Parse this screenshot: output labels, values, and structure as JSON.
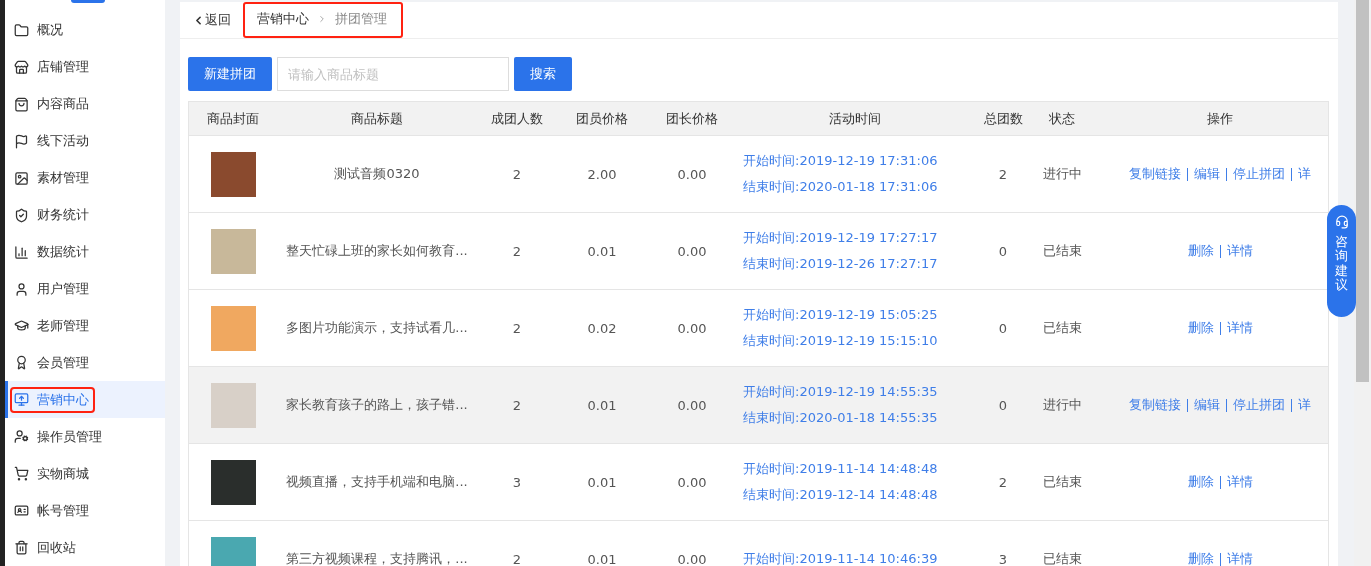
{
  "sidebar": {
    "items": [
      {
        "label": "概况",
        "selected": false
      },
      {
        "label": "店铺管理",
        "selected": false
      },
      {
        "label": "内容商品",
        "selected": false
      },
      {
        "label": "线下活动",
        "selected": false
      },
      {
        "label": "素材管理",
        "selected": false
      },
      {
        "label": "财务统计",
        "selected": false
      },
      {
        "label": "数据统计",
        "selected": false
      },
      {
        "label": "用户管理",
        "selected": false
      },
      {
        "label": "老师管理",
        "selected": false
      },
      {
        "label": "会员管理",
        "selected": false
      },
      {
        "label": "营销中心",
        "selected": true
      },
      {
        "label": "操作员管理",
        "selected": false
      },
      {
        "label": "实物商城",
        "selected": false
      },
      {
        "label": "帐号管理",
        "selected": false
      },
      {
        "label": "回收站",
        "selected": false
      }
    ]
  },
  "header": {
    "back": "返回",
    "breadcrumb": [
      "营销中心",
      "拼团管理"
    ]
  },
  "toolbar": {
    "new_button": "新建拼团",
    "search": {
      "placeholder": "请输入商品标题"
    },
    "search_button": "搜索"
  },
  "table": {
    "columns": [
      "商品封面",
      "商品标题",
      "成团人数",
      "团员价格",
      "团长价格",
      "活动时间",
      "总团数",
      "状态",
      "操作"
    ],
    "rows": [
      {
        "title": "测试音频0320",
        "size": "2",
        "member_price": "2.00",
        "leader_price": "0.00",
        "start": "开始时间:2019-12-19 17:31:06",
        "end": "结束时间:2020-01-18 17:31:06",
        "groups": "2",
        "status": "进行中",
        "actions": [
          "复制链接",
          "编辑",
          "停止拼团",
          "详"
        ],
        "highlighted": false
      },
      {
        "title": "整天忙碌上班的家长如何教育...",
        "size": "2",
        "member_price": "0.01",
        "leader_price": "0.00",
        "start": "开始时间:2019-12-19 17:27:17",
        "end": "结束时间:2019-12-26 17:27:17",
        "groups": "0",
        "status": "已结束",
        "actions": [
          "删除",
          "详情"
        ],
        "highlighted": false
      },
      {
        "title": "多图片功能演示，支持试看几...",
        "size": "2",
        "member_price": "0.02",
        "leader_price": "0.00",
        "start": "开始时间:2019-12-19 15:05:25",
        "end": "结束时间:2019-12-19 15:15:10",
        "groups": "0",
        "status": "已结束",
        "actions": [
          "删除",
          "详情"
        ],
        "highlighted": false
      },
      {
        "title": "家长教育孩子的路上，孩子错...",
        "size": "2",
        "member_price": "0.01",
        "leader_price": "0.00",
        "start": "开始时间:2019-12-19 14:55:35",
        "end": "结束时间:2020-01-18 14:55:35",
        "groups": "0",
        "status": "进行中",
        "actions": [
          "复制链接",
          "编辑",
          "停止拼团",
          "详"
        ],
        "highlighted": true
      },
      {
        "title": "视频直播，支持手机端和电脑...",
        "size": "3",
        "member_price": "0.01",
        "leader_price": "0.00",
        "start": "开始时间:2019-11-14 14:48:48",
        "end": "结束时间:2019-12-14 14:48:48",
        "groups": "2",
        "status": "已结束",
        "actions": [
          "删除",
          "详情"
        ],
        "highlighted": false
      },
      {
        "title": "第三方视频课程，支持腾讯，...",
        "size": "2",
        "member_price": "0.01",
        "leader_price": "0.00",
        "start": "开始时间:2019-11-14 10:46:39",
        "groups": "3",
        "status": "已结束",
        "actions": [
          "删除",
          "详情"
        ],
        "highlighted": false
      }
    ]
  },
  "feedback_button": "咨询建议"
}
